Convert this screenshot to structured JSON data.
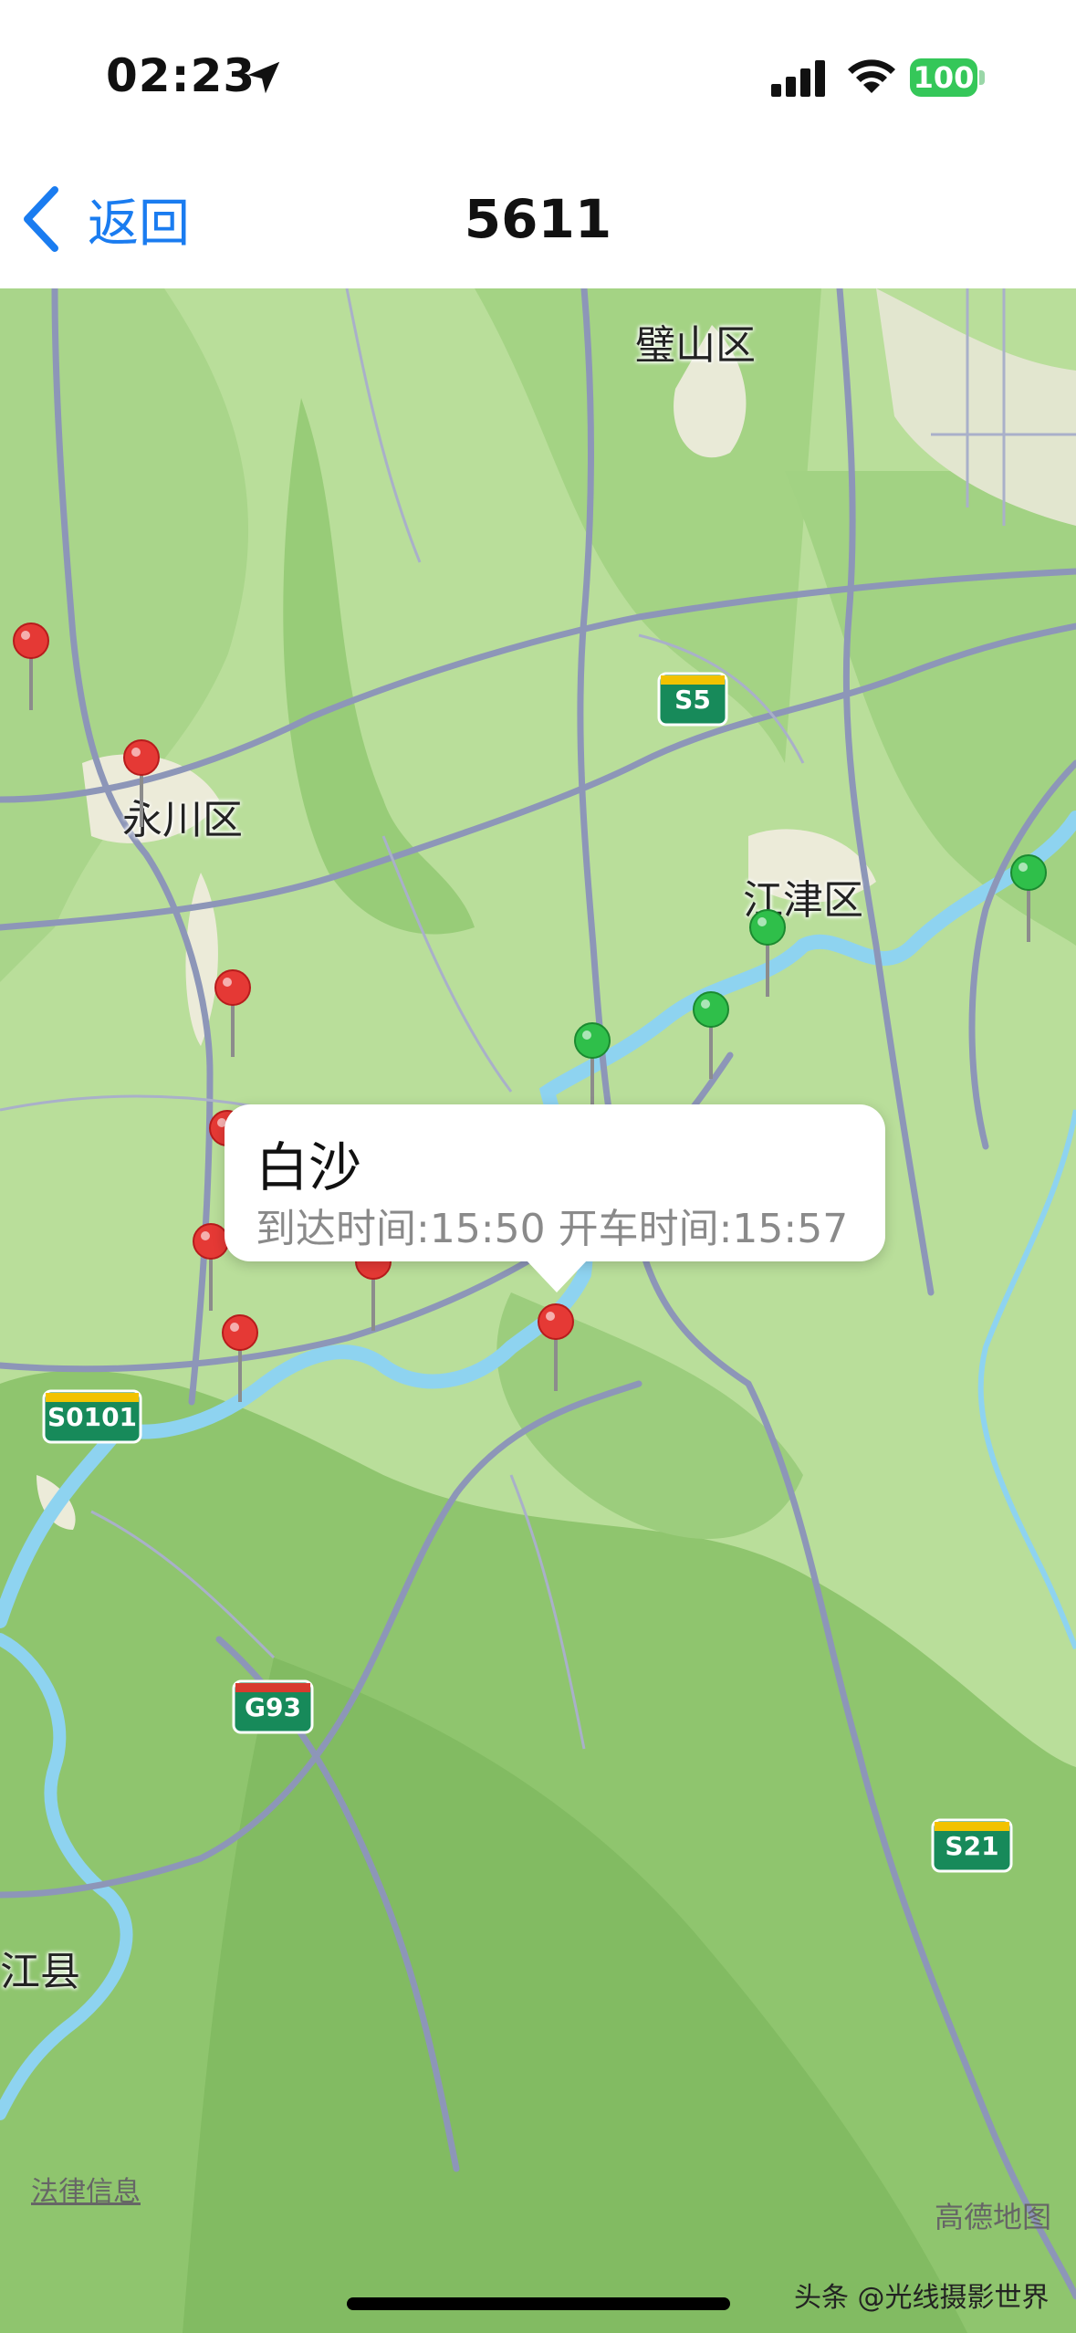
{
  "status_bar": {
    "time": "02:23",
    "battery": "100",
    "icons": [
      "location-arrow-icon",
      "cellular-signal-icon",
      "wifi-icon",
      "battery-icon"
    ]
  },
  "nav": {
    "back_label": "返回",
    "title": "5611"
  },
  "map": {
    "places": [
      "璧山区",
      "永川区",
      "江津区",
      "江县"
    ],
    "highway_shields": [
      "S5",
      "S0101",
      "G93",
      "S21"
    ],
    "callout": {
      "title": "白沙",
      "subtitle": "到达时间:15:50 开车时间:15:57"
    },
    "legal_link": "法律信息",
    "provider_logo": "高德地图",
    "watermark": "头条 @光线摄影世界",
    "pin_colors": {
      "visited": "#e53935",
      "upcoming": "#2fbf4a"
    }
  }
}
